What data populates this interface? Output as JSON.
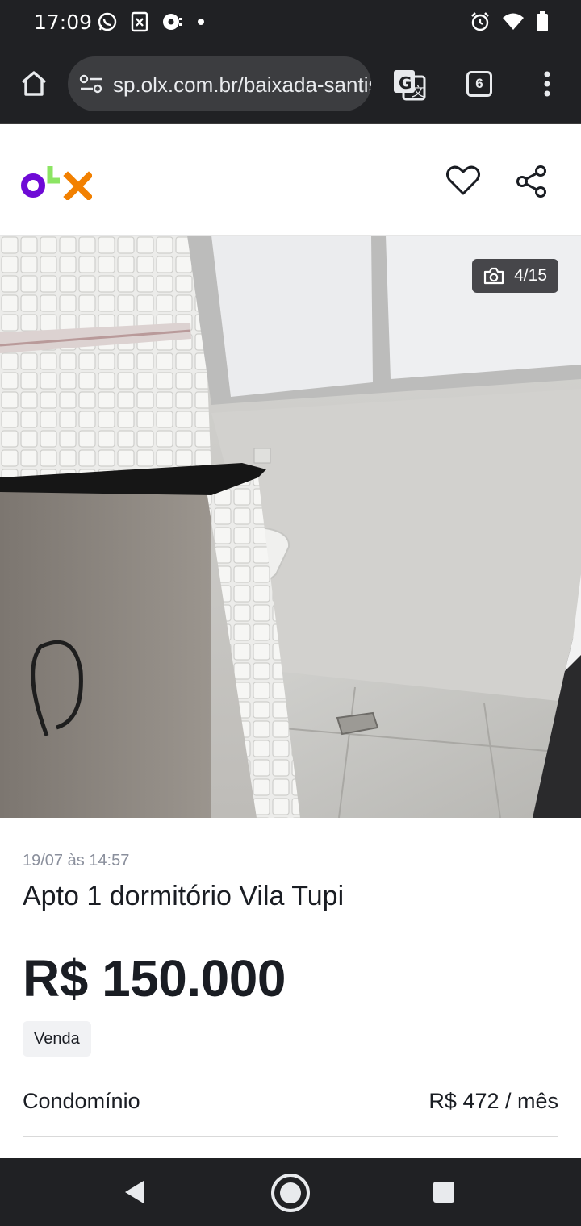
{
  "status_bar": {
    "time": "17:09",
    "left_icons": [
      "whatsapp-icon",
      "file-x-icon",
      "podcast-icon",
      "dot-icon"
    ],
    "right_icons": [
      "alarm-icon",
      "wifi-icon",
      "battery-icon"
    ]
  },
  "browser": {
    "url": "sp.olx.com.br/baixada-santista",
    "tab_count": "6",
    "icons": [
      "home-icon",
      "site-settings-icon",
      "translate-icon",
      "more-vert-icon"
    ]
  },
  "site_header": {
    "logo_text": "OLX",
    "brand_colors": {
      "o": "#6e0ad6",
      "l": "#8ce563",
      "x": "#f28000"
    },
    "actions": [
      "heart-icon",
      "share-icon"
    ]
  },
  "gallery": {
    "counter": "4/15",
    "counter_icon": "camera-icon"
  },
  "listing": {
    "posted_at": "19/07 às 14:57",
    "title": "Apto 1 dormitório Vila Tupi",
    "price": "R$ 150.000",
    "badge": "Venda",
    "condo_label": "Condomínio",
    "condo_value": "R$ 472 / mês"
  },
  "nav_bar": {
    "icons": [
      "back-icon",
      "home-circle-icon",
      "recents-icon"
    ]
  }
}
